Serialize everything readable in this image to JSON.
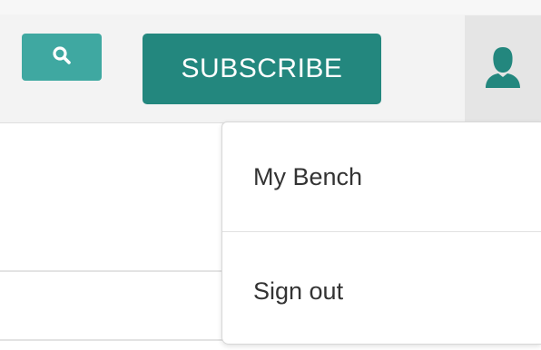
{
  "header": {
    "search_icon": "search-icon",
    "subscribe_label": "SUBSCRIBE",
    "account_icon": "user-icon"
  },
  "account_menu": {
    "items": [
      {
        "label": "My Bench"
      },
      {
        "label": "Sign out"
      }
    ]
  },
  "colors": {
    "search_button": "#3fa8a1",
    "subscribe_button": "#23877e",
    "account_icon": "#23877e",
    "header_background": "#f3f3f3"
  }
}
